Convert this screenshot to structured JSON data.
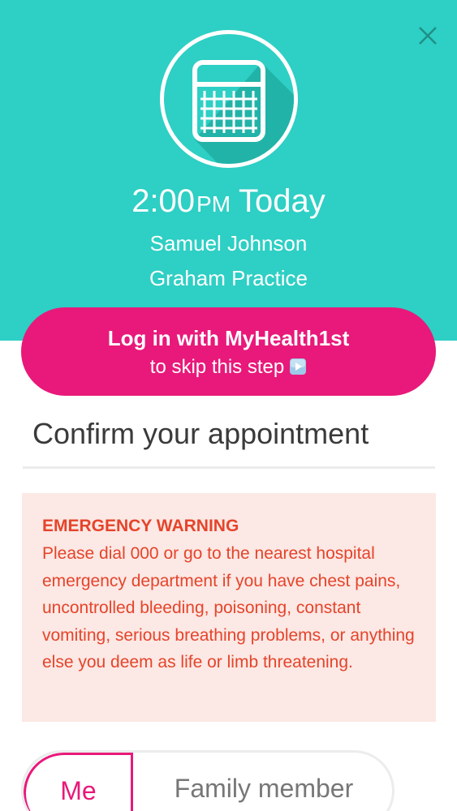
{
  "header": {
    "bg_color": "#2ecfc4",
    "close_icon": "close-icon",
    "calendar_icon": "calendar-icon",
    "time": "2:00",
    "ampm": "PM",
    "day": "Today",
    "doctor": "Samuel Johnson",
    "practice": "Graham Practice"
  },
  "login": {
    "color": "#e8197a",
    "main_label": "Log in with MyHealth1st",
    "sub_label": "to skip this step",
    "icon": "play-icon"
  },
  "confirm": {
    "title": "Confirm your appointment"
  },
  "warning": {
    "bg_color": "#fce8e4",
    "text_color": "#e5442b",
    "title": "EMERGENCY WARNING",
    "body": "Please dial 000 or go to the nearest hospital emergency department if you have chest pains, uncontrolled bleeding, poisoning, constant vomiting, serious breathing problems, or anything else you deem as life or limb threatening."
  },
  "patient_toggle": {
    "options": [
      "Me",
      "Family member"
    ],
    "selected": "Me"
  }
}
